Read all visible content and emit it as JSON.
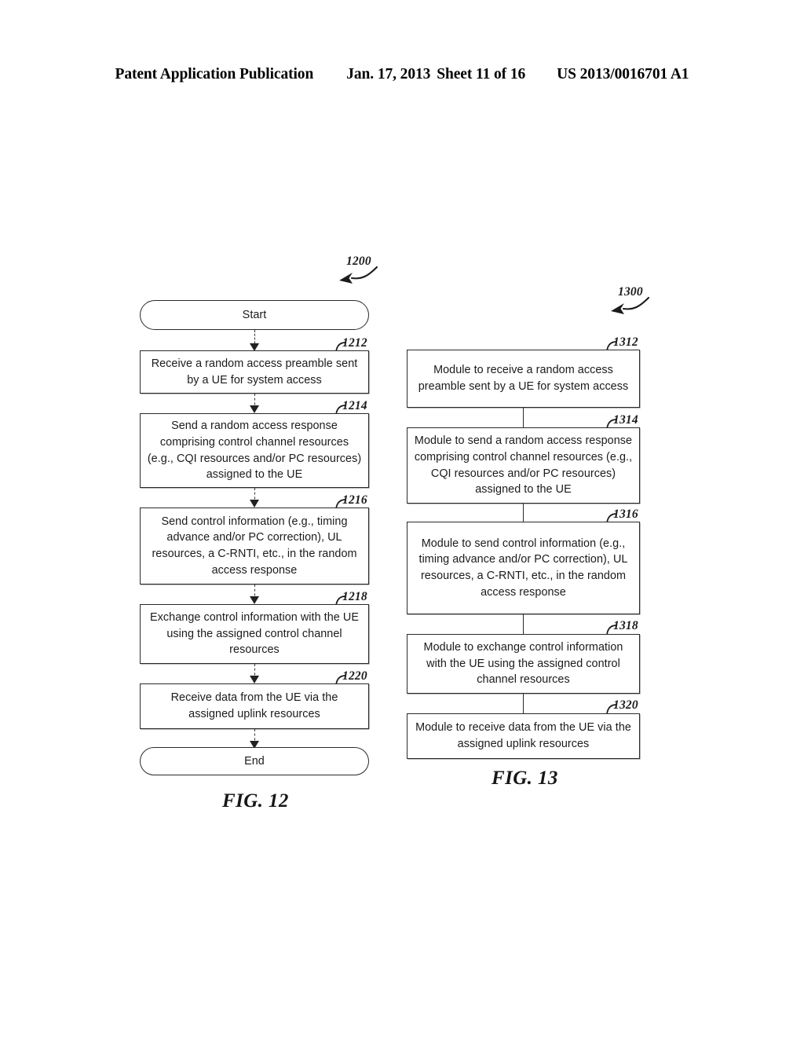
{
  "header": {
    "publication": "Patent Application Publication",
    "date": "Jan. 17, 2013",
    "sheet": "Sheet 11 of 16",
    "patent_number": "US 2013/0016701 A1"
  },
  "figures": [
    {
      "id": "fig-12",
      "caption": "FIG. 12",
      "diagram_number": "1200",
      "type": "flowchart",
      "nodes": [
        {
          "ref": null,
          "shape": "terminator",
          "text": "Start"
        },
        {
          "ref": "1212",
          "shape": "process",
          "text": "Receive a random access preamble sent by a UE for system access"
        },
        {
          "ref": "1214",
          "shape": "process",
          "text": "Send a random access response comprising control channel resources (e.g., CQI resources and/or PC resources) assigned to the UE"
        },
        {
          "ref": "1216",
          "shape": "process",
          "text": "Send control information (e.g., timing advance and/or PC correction), UL resources, a C-RNTI, etc., in the random access response"
        },
        {
          "ref": "1218",
          "shape": "process",
          "text": "Exchange control information with the UE using the assigned control channel resources"
        },
        {
          "ref": "1220",
          "shape": "process",
          "text": "Receive data from the UE via the assigned uplink resources"
        },
        {
          "ref": null,
          "shape": "terminator",
          "text": "End"
        }
      ]
    },
    {
      "id": "fig-13",
      "caption": "FIG. 13",
      "diagram_number": "1300",
      "type": "module-block-diagram",
      "nodes": [
        {
          "ref": "1312",
          "shape": "module",
          "text": "Module to receive a random access preamble sent by a UE for system access"
        },
        {
          "ref": "1314",
          "shape": "module",
          "text": "Module to send a random access response comprising control channel resources (e.g., CQI resources and/or PC resources) assigned to the UE"
        },
        {
          "ref": "1316",
          "shape": "module",
          "text": "Module to send control information (e.g., timing advance and/or PC correction), UL resources, a C-RNTI, etc., in the random access response"
        },
        {
          "ref": "1318",
          "shape": "module",
          "text": "Module to exchange control information with the UE using the assigned control channel resources"
        },
        {
          "ref": "1320",
          "shape": "module",
          "text": "Module to receive data from the UE via the assigned uplink resources"
        }
      ]
    }
  ]
}
